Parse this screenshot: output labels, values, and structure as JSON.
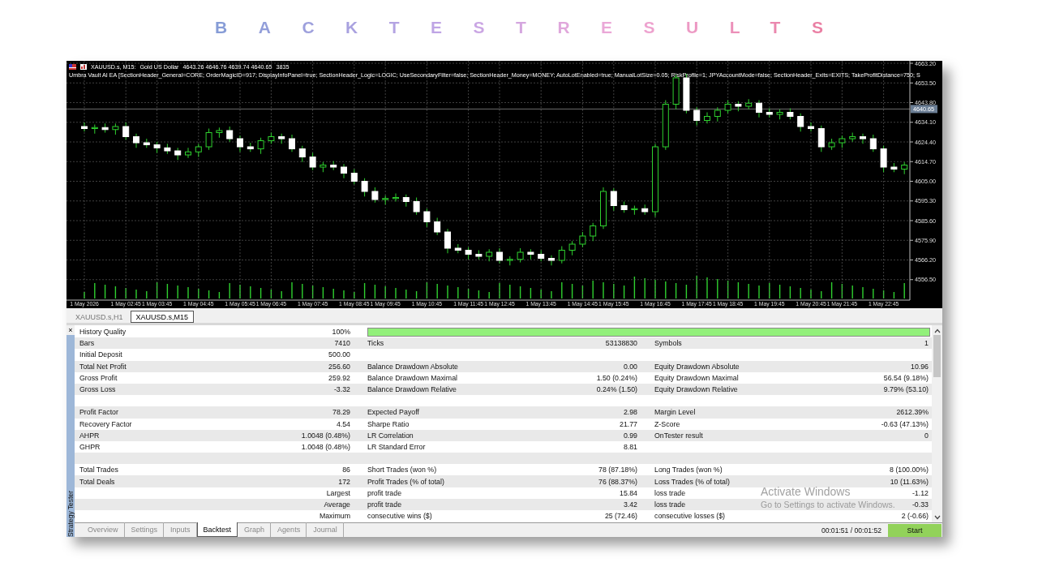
{
  "title": "BACKTESTRESULTS",
  "chart": {
    "symbol": "XAUUSD.s, M15:",
    "description": "Gold US Dollar",
    "ohlc": "4643.26 4646.76 4639.74 4640.65",
    "volume": "3835",
    "ea_line": "Umbra Vault AI EA [SectionHeader_General=CORE; OrderMagicID=917; DisplayInfoPanel=true; SectionHeader_Logic=LOGIC; UseSecondaryFilter=false; SectionHeader_Money=MONEY; AutoLotEnabled=true; ManualLotSize=0.05; RiskProfile=1; JPYAccountMode=false; SectionHeader_Exits=EXITS; TakeProfitDistance=750; S",
    "chart_data": {
      "type": "candlestick",
      "ylim": [
        4546.4,
        4664.4
      ],
      "grid": true,
      "ref_lines": [
        {
          "axis": "y",
          "value": 4640.65,
          "label": "4640.65"
        }
      ],
      "yticks": [
        {
          "value": 4663.2,
          "label": "4663.20"
        },
        {
          "value": 4653.5,
          "label": "4653.50"
        },
        {
          "value": 4643.8,
          "label": "4643.80"
        },
        {
          "value": 4634.1,
          "label": "4634.10"
        },
        {
          "value": 4624.4,
          "label": "4624.40"
        },
        {
          "value": 4614.7,
          "label": "4614.70"
        },
        {
          "value": 4605.0,
          "label": "4605.00"
        },
        {
          "value": 4595.3,
          "label": "4595.30"
        },
        {
          "value": 4585.6,
          "label": "4585.60"
        },
        {
          "value": 4575.9,
          "label": "4575.90"
        },
        {
          "value": 4566.2,
          "label": "4566.20"
        },
        {
          "value": 4556.5,
          "label": "4556.50"
        }
      ],
      "categories": [
        "1 May 2026",
        null,
        null,
        null,
        "1 May 02:45",
        null,
        null,
        "1 May 03:45",
        null,
        null,
        null,
        "1 May 04:45",
        null,
        null,
        null,
        "1 May 05:45",
        null,
        null,
        "1 May 06:45",
        null,
        null,
        null,
        "1 May 07:45",
        null,
        null,
        null,
        "1 May 08:45",
        null,
        null,
        "1 May 09:45",
        null,
        null,
        null,
        "1 May 10:45",
        null,
        null,
        null,
        "1 May 11:45",
        null,
        null,
        "1 May 12:45",
        null,
        null,
        null,
        "1 May 13:45",
        null,
        null,
        null,
        "1 May 14:45",
        null,
        null,
        "1 May 15:45",
        null,
        null,
        null,
        "1 May 16:45",
        null,
        null,
        null,
        "1 May 17:45",
        null,
        null,
        "1 May 18:45",
        null,
        null,
        null,
        "1 May 19:45",
        null,
        null,
        null,
        "1 May 20:45",
        null,
        null,
        "1 May 21:45",
        null,
        null,
        null,
        "1 May 22:45",
        null,
        null
      ],
      "ohlc": [
        [
          4632,
          4634,
          4629.5,
          4631
        ],
        [
          4631,
          4633,
          4628.5,
          4631.5
        ],
        [
          4631.5,
          4633.5,
          4629,
          4630.5
        ],
        [
          4630.5,
          4633.5,
          4628,
          4632
        ],
        [
          4632,
          4634,
          4625.5,
          4627
        ],
        [
          4627,
          4628.5,
          4621.5,
          4624
        ],
        [
          4624,
          4626,
          4621.5,
          4623
        ],
        [
          4623,
          4624.5,
          4619,
          4621.5
        ],
        [
          4621.5,
          4623.5,
          4618.5,
          4620
        ],
        [
          4620,
          4621.5,
          4615.5,
          4618
        ],
        [
          4618,
          4621.5,
          4616.5,
          4619.5
        ],
        [
          4619.5,
          4623.5,
          4617,
          4622
        ],
        [
          4622,
          4631,
          4620.5,
          4629
        ],
        [
          4629,
          4631.5,
          4626.5,
          4630
        ],
        [
          4630,
          4632,
          4624.5,
          4626
        ],
        [
          4626,
          4627.5,
          4619.5,
          4622
        ],
        [
          4622,
          4624,
          4619.5,
          4621
        ],
        [
          4621,
          4626.5,
          4618.5,
          4625
        ],
        [
          4625,
          4629,
          4623.5,
          4627
        ],
        [
          4627,
          4628.5,
          4623.5,
          4626
        ],
        [
          4626,
          4628,
          4619.5,
          4621
        ],
        [
          4621,
          4622.5,
          4614.5,
          4617
        ],
        [
          4617,
          4619,
          4610.5,
          4612
        ],
        [
          4612,
          4614.5,
          4609.5,
          4613
        ],
        [
          4613,
          4615,
          4610.5,
          4612
        ],
        [
          4612,
          4613.5,
          4606.5,
          4609
        ],
        [
          4609,
          4611,
          4603.5,
          4605
        ],
        [
          4605,
          4606.5,
          4597.5,
          4600
        ],
        [
          4600,
          4602,
          4594.5,
          4596
        ],
        [
          4596,
          4598,
          4593.5,
          4596.5
        ],
        [
          4596.5,
          4599,
          4595,
          4597
        ],
        [
          4597,
          4598.5,
          4592.5,
          4595
        ],
        [
          4595,
          4597,
          4588.5,
          4590
        ],
        [
          4590,
          4591.5,
          4582.5,
          4585
        ],
        [
          4585,
          4587,
          4578.5,
          4580
        ],
        [
          4580,
          4581.5,
          4569.5,
          4572
        ],
        [
          4572,
          4574,
          4569.5,
          4571
        ],
        [
          4571,
          4572.5,
          4566.5,
          4569
        ],
        [
          4569,
          4571,
          4566.5,
          4568
        ],
        [
          4568,
          4571.5,
          4565.5,
          4570
        ],
        [
          4570,
          4572,
          4564.5,
          4566
        ],
        [
          4566,
          4568,
          4563.5,
          4566.5
        ],
        [
          4566.5,
          4572,
          4565,
          4570
        ],
        [
          4570,
          4571.5,
          4566.5,
          4569
        ],
        [
          4569,
          4571,
          4565.5,
          4567
        ],
        [
          4567,
          4568.5,
          4563.5,
          4566
        ],
        [
          4566,
          4573,
          4564.5,
          4571
        ],
        [
          4571,
          4575.5,
          4568.5,
          4574
        ],
        [
          4574,
          4580,
          4572.5,
          4578
        ],
        [
          4578,
          4584.5,
          4575.5,
          4583
        ],
        [
          4583,
          4602,
          4581.5,
          4600
        ],
        [
          4600,
          4601.5,
          4590.5,
          4593
        ],
        [
          4593,
          4595,
          4589.5,
          4591
        ],
        [
          4591,
          4593,
          4588.5,
          4591.5
        ],
        [
          4591.5,
          4593.5,
          4588.5,
          4590
        ],
        [
          4590,
          4623.5,
          4587.5,
          4622
        ],
        [
          4622,
          4645,
          4620.5,
          4643
        ],
        [
          4643,
          4657.5,
          4640.5,
          4656
        ],
        [
          4656,
          4658,
          4638.5,
          4640
        ],
        [
          4640,
          4641.5,
          4632.5,
          4635
        ],
        [
          4635,
          4639,
          4633.5,
          4637
        ],
        [
          4637,
          4641.5,
          4634.5,
          4640
        ],
        [
          4640,
          4645,
          4638.5,
          4643
        ],
        [
          4643,
          4644.5,
          4639.5,
          4642
        ],
        [
          4642,
          4645.5,
          4640.5,
          4643.5
        ],
        [
          4643.5,
          4645,
          4636.5,
          4639
        ],
        [
          4639,
          4641,
          4636.5,
          4638
        ],
        [
          4638,
          4640.5,
          4635.5,
          4639
        ],
        [
          4639,
          4641,
          4635.5,
          4637
        ],
        [
          4637,
          4638.5,
          4629.5,
          4632
        ],
        [
          4632,
          4634,
          4629.5,
          4631
        ],
        [
          4631,
          4632.5,
          4619.5,
          4622
        ],
        [
          4622,
          4626,
          4620.5,
          4624
        ],
        [
          4624,
          4627.5,
          4621.5,
          4626
        ],
        [
          4626,
          4629,
          4624.5,
          4627
        ],
        [
          4627,
          4628.5,
          4623.5,
          4626
        ],
        [
          4626,
          4628,
          4619.5,
          4621
        ],
        [
          4621,
          4622.5,
          4609.5,
          4612
        ],
        [
          4612,
          4614,
          4609.5,
          4611
        ],
        [
          4611,
          4614.5,
          4608.5,
          4613
        ]
      ]
    }
  },
  "chart_tabs": [
    {
      "label": "XAUUSD.s,H1",
      "selected": false
    },
    {
      "label": "XAUUSD.s,M15",
      "selected": true
    }
  ],
  "panel": {
    "close_button": "×",
    "title": "Strategy Tester",
    "rows": [
      {
        "kind": "quality",
        "label": "History Quality",
        "value": "100%",
        "level": 1
      },
      {
        "kind": "stats",
        "cells": [
          {
            "label": "Bars",
            "value": "7410"
          },
          {
            "label": "Ticks",
            "value": "53138830"
          },
          {
            "label": "Symbols",
            "value": "1"
          }
        ]
      },
      {
        "kind": "stats",
        "cells": [
          {
            "label": "Initial Deposit",
            "value": "500.00"
          }
        ]
      },
      {
        "kind": "stats",
        "cells": [
          {
            "label": "Total Net Profit",
            "value": "256.60"
          },
          {
            "label": "Balance Drawdown Absolute",
            "value": "0.00"
          },
          {
            "label": "Equity Drawdown Absolute",
            "value": "10.96"
          }
        ]
      },
      {
        "kind": "stats",
        "cells": [
          {
            "label": "Gross Profit",
            "value": "259.92"
          },
          {
            "label": "Balance Drawdown Maximal",
            "value": "1.50 (0.24%)"
          },
          {
            "label": "Equity Drawdown Maximal",
            "value": "56.54 (9.18%)"
          }
        ]
      },
      {
        "kind": "stats",
        "cells": [
          {
            "label": "Gross Loss",
            "value": "-3.32"
          },
          {
            "label": "Balance Drawdown Relative",
            "value": "0.24% (1.50)"
          },
          {
            "label": "Equity Drawdown Relative",
            "value": "9.79% (53.10)"
          }
        ]
      },
      {
        "kind": "blank"
      },
      {
        "kind": "stats",
        "cells": [
          {
            "label": "Profit Factor",
            "value": "78.29"
          },
          {
            "label": "Expected Payoff",
            "value": "2.98"
          },
          {
            "label": "Margin Level",
            "value": "2612.39%"
          }
        ]
      },
      {
        "kind": "stats",
        "cells": [
          {
            "label": "Recovery Factor",
            "value": "4.54"
          },
          {
            "label": "Sharpe Ratio",
            "value": "21.77"
          },
          {
            "label": "Z-Score",
            "value": "-0.63 (47.13%)"
          }
        ]
      },
      {
        "kind": "stats",
        "cells": [
          {
            "label": "AHPR",
            "value": "1.0048 (0.48%)"
          },
          {
            "label": "LR Correlation",
            "value": "0.99"
          },
          {
            "label": "OnTester result",
            "value": "0"
          }
        ]
      },
      {
        "kind": "stats",
        "cells": [
          {
            "label": "GHPR",
            "value": "1.0048 (0.48%)"
          },
          {
            "label": "LR Standard Error",
            "value": "8.81"
          }
        ]
      },
      {
        "kind": "blank"
      },
      {
        "kind": "stats",
        "cells": [
          {
            "label": "Total Trades",
            "value": "86"
          },
          {
            "label": "Short Trades (won %)",
            "value": "78 (87.18%)"
          },
          {
            "label": "Long Trades (won %)",
            "value": "8 (100.00%)"
          }
        ]
      },
      {
        "kind": "stats",
        "cells": [
          {
            "label": "Total Deals",
            "value": "172"
          },
          {
            "label": "Profit Trades (% of total)",
            "value": "76 (88.37%)"
          },
          {
            "label": "Loss Trades (% of total)",
            "value": "10 (11.63%)"
          }
        ]
      },
      {
        "kind": "stats",
        "cells": [
          {
            "value": "Largest"
          },
          {
            "label": "profit trade",
            "value": "15.84"
          },
          {
            "label": "loss trade",
            "value": "-1.12"
          }
        ]
      },
      {
        "kind": "stats",
        "cells": [
          {
            "value": "Average"
          },
          {
            "label": "profit trade",
            "value": "3.42"
          },
          {
            "label": "loss trade",
            "value": "-0.33"
          }
        ]
      },
      {
        "kind": "stats",
        "cells": [
          {
            "value": "Maximum"
          },
          {
            "label": "consecutive wins ($)",
            "value": "25 (72.46)"
          },
          {
            "label": "consecutive losses ($)",
            "value": "2 (-0.66)"
          }
        ]
      }
    ],
    "tabs": [
      {
        "label": "Overview",
        "selected": false
      },
      {
        "label": "Settings",
        "selected": false
      },
      {
        "label": "Inputs",
        "selected": false
      },
      {
        "label": "Backtest",
        "selected": true
      },
      {
        "label": "Graph",
        "selected": false
      },
      {
        "label": "Agents",
        "selected": false
      },
      {
        "label": "Journal",
        "selected": false
      }
    ],
    "timer": "00:01:51 / 00:01:52",
    "start_button": "Start"
  },
  "system_notice": {
    "title": "Activate Windows",
    "subtitle": "Go to Settings to activate Windows."
  }
}
